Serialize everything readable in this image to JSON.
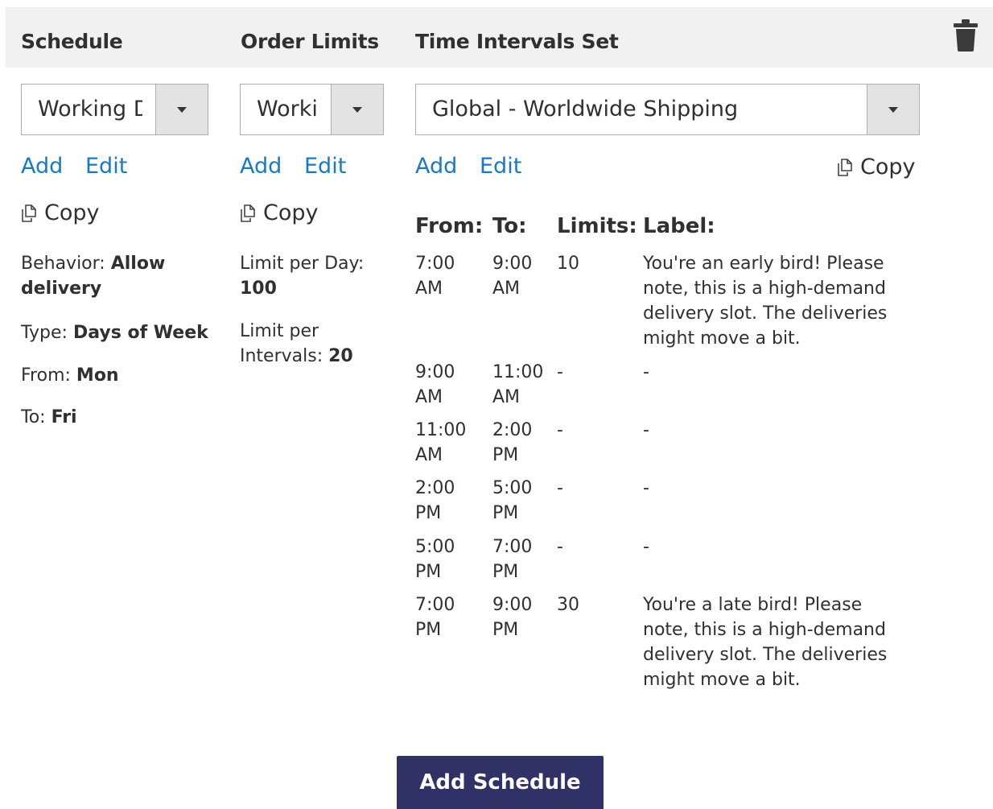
{
  "header": {
    "schedule": "Schedule",
    "order_limits": "Order Limits",
    "time_intervals": "Time Intervals Set"
  },
  "schedule": {
    "select_value": "Working D",
    "add": "Add",
    "edit": "Edit",
    "copy": "Copy",
    "behavior_label": "Behavior: ",
    "behavior_value": "Allow delivery",
    "type_label": "Type: ",
    "type_value": "Days of Week",
    "from_label": "From: ",
    "from_value": "Mon",
    "to_label": "To: ",
    "to_value": "Fri"
  },
  "order_limits": {
    "select_value": "Worki",
    "add": "Add",
    "edit": "Edit",
    "copy": "Copy",
    "per_day_label": "Limit per Day:",
    "per_day_value": "100",
    "per_interval_label": "Limit per Intervals: ",
    "per_interval_value": "20"
  },
  "time_intervals": {
    "select_value": "Global - Worldwide Shipping",
    "add": "Add",
    "edit": "Edit",
    "copy": "Copy",
    "columns": [
      "From:",
      "To:",
      "Limits:",
      "Label:"
    ],
    "rows": [
      {
        "from": "7:00 AM",
        "to": "9:00 AM",
        "limit": "10",
        "label": "You're an early bird! Please note, this is a high-demand delivery slot. The deliveries might move a bit."
      },
      {
        "from": "9:00 AM",
        "to": "11:00 AM",
        "limit": "-",
        "label": "-"
      },
      {
        "from": "11:00 AM",
        "to": "2:00 PM",
        "limit": "-",
        "label": "-"
      },
      {
        "from": "2:00 PM",
        "to": "5:00 PM",
        "limit": "-",
        "label": "-"
      },
      {
        "from": "5:00 PM",
        "to": "7:00 PM",
        "limit": "-",
        "label": "-"
      },
      {
        "from": "7:00 PM",
        "to": "9:00 PM",
        "limit": "30",
        "label": "You're a late bird! Please note, this is a high-demand delivery slot. The deliveries might move a bit."
      }
    ]
  },
  "actions": {
    "add_schedule": "Add Schedule"
  },
  "colors": {
    "link": "#1979c3",
    "primary_button": "#2f3167",
    "header_bg": "#f1f1f1"
  },
  "icons": {
    "delete": "trash-icon",
    "copy": "copy-icon",
    "dropdown": "chevron-down-icon"
  }
}
